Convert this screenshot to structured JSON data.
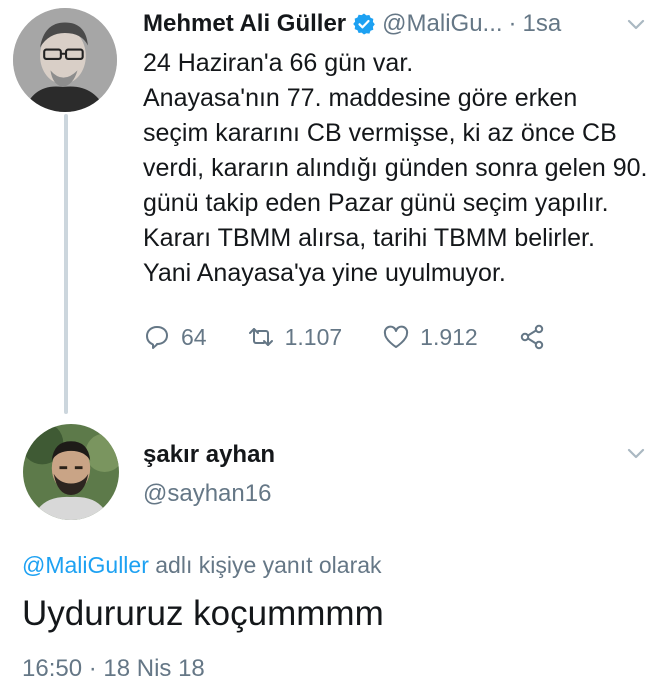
{
  "colors": {
    "text": "#14171a",
    "secondary": "#657786",
    "accent": "#1da1f2",
    "thread_line": "#ccd6dd"
  },
  "tweet1": {
    "author_name": "Mehmet Ali Güller",
    "verified_icon": "verified-badge-icon",
    "handle": "@MaliGu...",
    "separator": "·",
    "time": "1sa",
    "text": "24 Haziran'a 66 gün var.\nAnayasa'nın 77. maddesine göre erken seçim kararını CB vermişse, ki az önce CB verdi, kararın alındığı günden sonra gelen 90. günü takip eden Pazar günü seçim yapılır. Kararı TBMM alırsa, tarihi TBMM belirler.\nYani Anayasa'ya yine uyulmuyor.",
    "actions": {
      "replies": "64",
      "retweets": "1.107",
      "likes": "1.912"
    }
  },
  "tweet2": {
    "author_name": "şakır ayhan",
    "handle": "@sayhan16",
    "reply_mention": "@MaliGuller",
    "reply_suffix": " adlı kişiye yanıt olarak",
    "text": "Uydururuz koçummmm",
    "timestamp": "16:50 · 18 Nis 18"
  }
}
